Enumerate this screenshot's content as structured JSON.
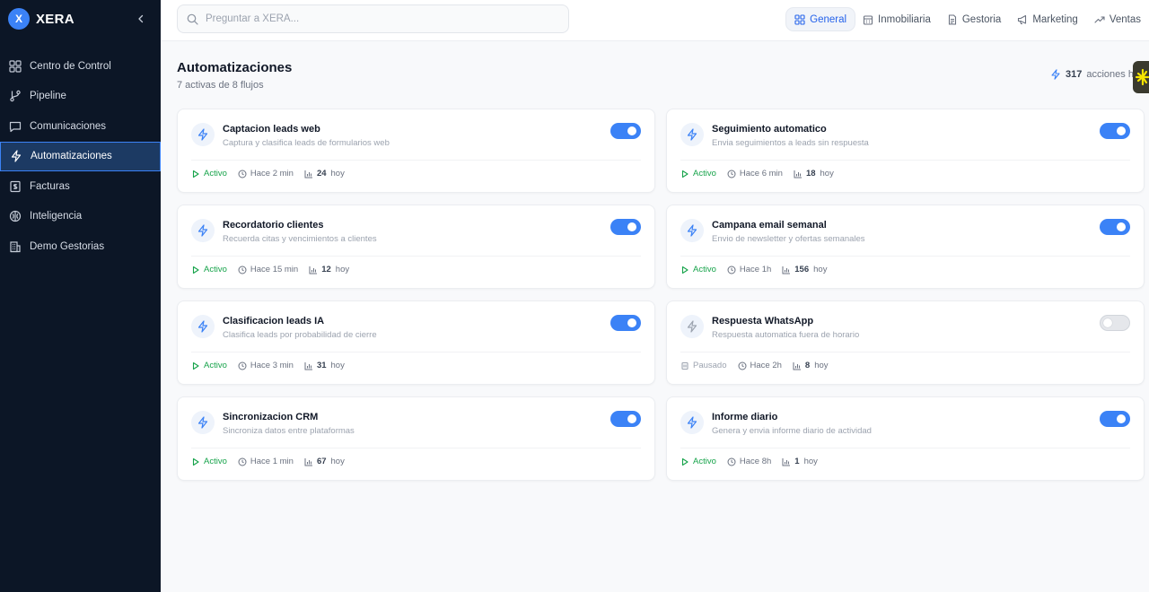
{
  "brand": {
    "logo_letter": "X",
    "name": "XERA"
  },
  "sidebar": {
    "items": [
      {
        "label": "Centro de Control",
        "icon": "grid-icon"
      },
      {
        "label": "Pipeline",
        "icon": "git-branch-icon"
      },
      {
        "label": "Comunicaciones",
        "icon": "message-icon"
      },
      {
        "label": "Automatizaciones",
        "icon": "lightning-icon",
        "active": true
      },
      {
        "label": "Facturas",
        "icon": "receipt-icon"
      },
      {
        "label": "Inteligencia",
        "icon": "brain-icon"
      },
      {
        "label": "Demo Gestorias",
        "icon": "building-icon"
      }
    ]
  },
  "search": {
    "placeholder": "Preguntar a XERA..."
  },
  "tabs": [
    {
      "label": "General",
      "icon": "grid-icon",
      "active": true
    },
    {
      "label": "Inmobiliaria",
      "icon": "building-icon"
    },
    {
      "label": "Gestoria",
      "icon": "document-icon"
    },
    {
      "label": "Marketing",
      "icon": "megaphone-icon"
    },
    {
      "label": "Ventas",
      "icon": "trending-up-icon"
    }
  ],
  "page": {
    "title": "Automatizaciones",
    "subtitle": "7 activas de 8 flujos",
    "actions_count": "317",
    "actions_label": "acciones h"
  },
  "cards": [
    {
      "title": "Captacion leads web",
      "desc": "Captura y clasifica leads de formularios web",
      "enabled": true,
      "status": "Activo",
      "time": "Hace 2 min",
      "count": "24",
      "unit": "hoy"
    },
    {
      "title": "Seguimiento automatico",
      "desc": "Envia seguimientos a leads sin respuesta",
      "enabled": true,
      "status": "Activo",
      "time": "Hace 6 min",
      "count": "18",
      "unit": "hoy"
    },
    {
      "title": "Recordatorio clientes",
      "desc": "Recuerda citas y vencimientos a clientes",
      "enabled": true,
      "status": "Activo",
      "time": "Hace 15 min",
      "count": "12",
      "unit": "hoy"
    },
    {
      "title": "Campana email semanal",
      "desc": "Envio de newsletter y ofertas semanales",
      "enabled": true,
      "status": "Activo",
      "time": "Hace 1h",
      "count": "156",
      "unit": "hoy"
    },
    {
      "title": "Clasificacion leads IA",
      "desc": "Clasifica leads por probabilidad de cierre",
      "enabled": true,
      "status": "Activo",
      "time": "Hace 3 min",
      "count": "31",
      "unit": "hoy"
    },
    {
      "title": "Respuesta WhatsApp",
      "desc": "Respuesta automatica fuera de horario",
      "enabled": false,
      "status": "Pausado",
      "time": "Hace 2h",
      "count": "8",
      "unit": "hoy"
    },
    {
      "title": "Sincronizacion CRM",
      "desc": "Sincroniza datos entre plataformas",
      "enabled": true,
      "status": "Activo",
      "time": "Hace 1 min",
      "count": "67",
      "unit": "hoy"
    },
    {
      "title": "Informe diario",
      "desc": "Genera y envia informe diario de actividad",
      "enabled": true,
      "status": "Activo",
      "time": "Hace 8h",
      "count": "1",
      "unit": "hoy"
    }
  ],
  "colors": {
    "accent": "#3b82f6",
    "sidebar_bg": "#0c1626",
    "active_status": "#16a34a"
  }
}
